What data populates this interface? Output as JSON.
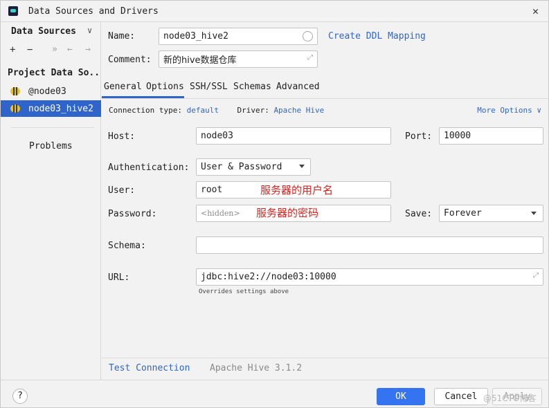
{
  "window": {
    "title": "Data Sources and Drivers",
    "close_icon": "close-icon"
  },
  "sidebar": {
    "header": "Data Sources",
    "header_icon": "chevron-down-icon",
    "toolbar": {
      "add": "+",
      "remove": "−",
      "more": "»",
      "back": "←",
      "forward": "→"
    },
    "project_header": "Project Data So..",
    "items": [
      {
        "label": "@node03",
        "icon": "hive-bee-icon",
        "selected": false
      },
      {
        "label": "node03_hive2",
        "icon": "hive-bee-icon",
        "selected": true
      }
    ],
    "problems": "Problems"
  },
  "form": {
    "name_label": "Name:",
    "name_value": "node03_hive2",
    "ddl_link": "Create DDL Mapping",
    "comment_label": "Comment:",
    "comment_value": "新的hive数据仓库",
    "tabs": [
      "General",
      "Options",
      "SSH/SSL",
      "Schemas",
      "Advanced"
    ],
    "active_tab": "General",
    "connection_type_label": "Connection type:",
    "connection_type_value": "default",
    "driver_label": "Driver:",
    "driver_value": "Apache Hive",
    "more_options": "More Options",
    "host_label": "Host:",
    "host_value": "node03",
    "port_label": "Port:",
    "port_value": "10000",
    "auth_label": "Authentication:",
    "auth_value": "User & Password",
    "user_label": "User:",
    "user_value": "root",
    "user_annotation": "服务器的用户名",
    "password_label": "Password:",
    "password_placeholder": "<hidden>",
    "password_annotation": "服务器的密码",
    "save_label": "Save:",
    "save_value": "Forever",
    "schema_label": "Schema:",
    "schema_value": "",
    "url_label": "URL:",
    "url_value": "jdbc:hive2://node03:10000",
    "url_hint": "Overrides settings above",
    "test_connection": "Test Connection",
    "driver_version": "Apache Hive 3.1.2"
  },
  "footer": {
    "help": "?",
    "ok": "OK",
    "cancel": "Cancel",
    "apply": "Apply",
    "watermark": "@51CTO博客"
  },
  "colors": {
    "accent": "#2f65ca",
    "ok_button": "#3574f0",
    "annotation": "#e0201b"
  }
}
